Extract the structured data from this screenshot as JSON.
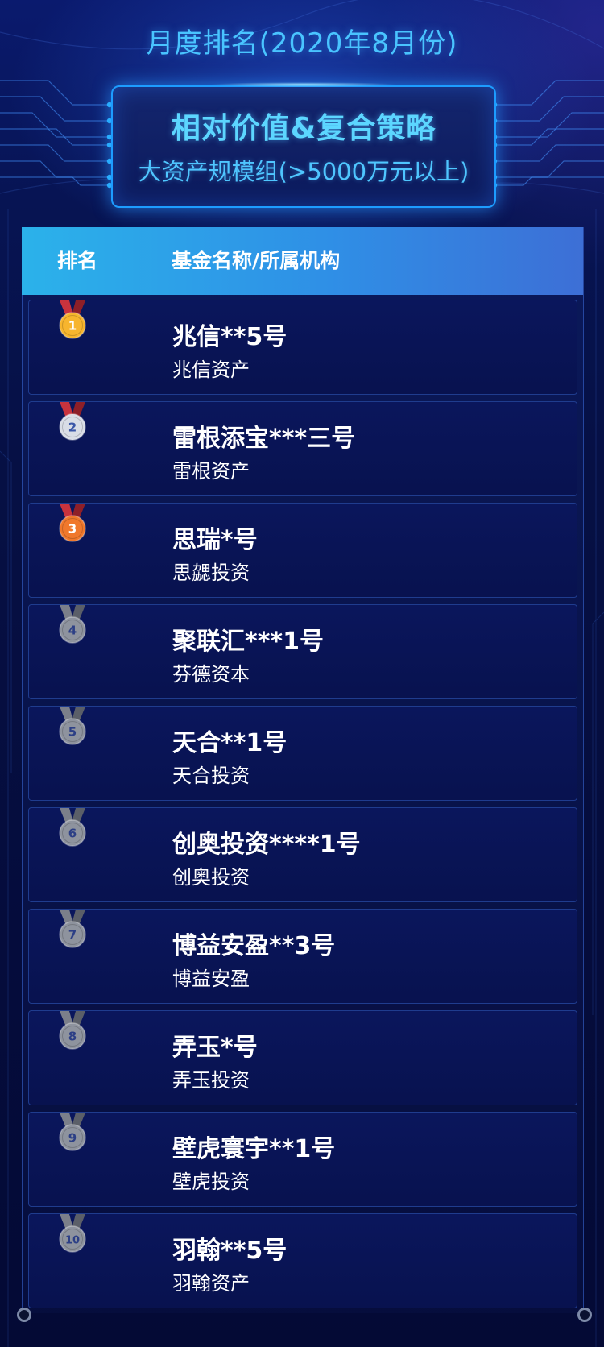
{
  "header": {
    "title": "月度排名(2020年8月份)",
    "subtitle_line1": "相对价值&复合策略",
    "subtitle_line2": "大资产规模组(>5000万元以上)"
  },
  "table": {
    "col_rank": "排名",
    "col_name": "基金名称/所属机构"
  },
  "rows": [
    {
      "rank": "1",
      "medal": "gold",
      "fund": "兆信**5号",
      "org": "兆信资产"
    },
    {
      "rank": "2",
      "medal": "silver",
      "fund": "雷根添宝***三号",
      "org": "雷根资产"
    },
    {
      "rank": "3",
      "medal": "bronze",
      "fund": "思瑞*号",
      "org": "思勰投资"
    },
    {
      "rank": "4",
      "medal": "gray",
      "fund": "聚联汇***1号",
      "org": "芬德资本"
    },
    {
      "rank": "5",
      "medal": "gray",
      "fund": "天合**1号",
      "org": "天合投资"
    },
    {
      "rank": "6",
      "medal": "gray",
      "fund": "创奥投资****1号",
      "org": "创奥投资"
    },
    {
      "rank": "7",
      "medal": "gray",
      "fund": "博益安盈**3号",
      "org": "博益安盈"
    },
    {
      "rank": "8",
      "medal": "gray",
      "fund": "弄玉*号",
      "org": "弄玉投资"
    },
    {
      "rank": "9",
      "medal": "gray",
      "fund": "壁虎寰宇**1号",
      "org": "壁虎投资"
    },
    {
      "rank": "10",
      "medal": "gray",
      "fund": "羽翰**5号",
      "org": "羽翰资产"
    }
  ],
  "colors": {
    "accent": "#49c4ff",
    "header_gradient_start": "#2bb2ea",
    "header_gradient_end": "#3d6fd6",
    "gold": "#f7b52e",
    "silver": "#d9dde6",
    "bronze": "#f0782c",
    "gray": "#8e939e"
  }
}
